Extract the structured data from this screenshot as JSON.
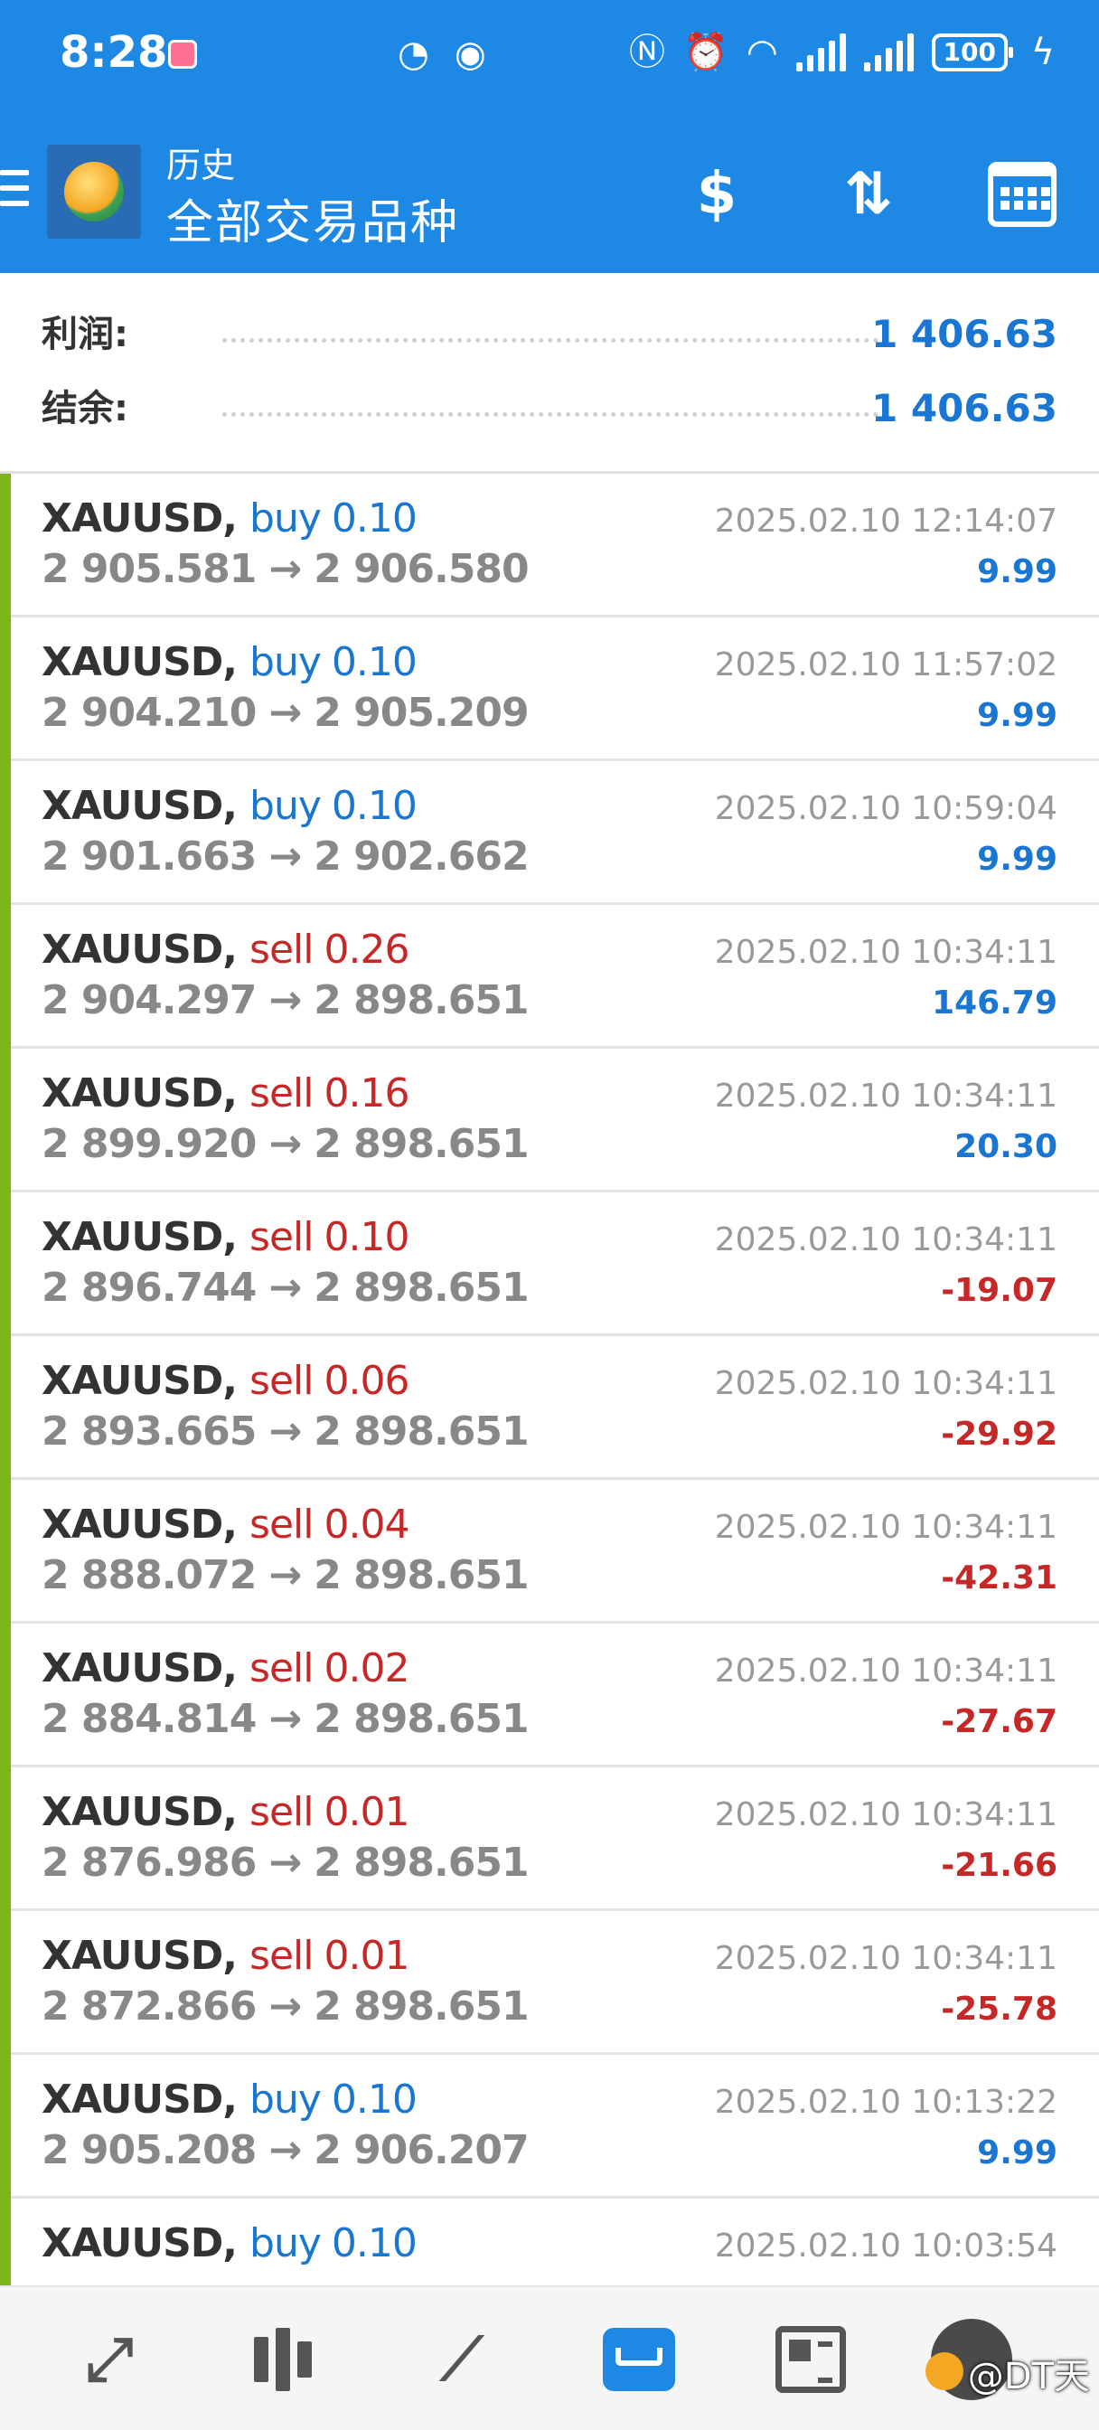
{
  "status_bar": {
    "time": "8:28",
    "battery": "100"
  },
  "app_bar": {
    "subtitle": "历史",
    "title": "全部交易品种"
  },
  "summary": {
    "profit_label": "利润:",
    "profit_value": "1 406.63",
    "balance_label": "结余:",
    "balance_value": "1 406.63"
  },
  "trades": [
    {
      "symbol": "XAUUSD,",
      "side": "buy",
      "volume": "0.10",
      "open": "2 905.581",
      "close": "2 906.580",
      "time": "2025.02.10 12:14:07",
      "profit": "9.99"
    },
    {
      "symbol": "XAUUSD,",
      "side": "buy",
      "volume": "0.10",
      "open": "2 904.210",
      "close": "2 905.209",
      "time": "2025.02.10 11:57:02",
      "profit": "9.99"
    },
    {
      "symbol": "XAUUSD,",
      "side": "buy",
      "volume": "0.10",
      "open": "2 901.663",
      "close": "2 902.662",
      "time": "2025.02.10 10:59:04",
      "profit": "9.99"
    },
    {
      "symbol": "XAUUSD,",
      "side": "sell",
      "volume": "0.26",
      "open": "2 904.297",
      "close": "2 898.651",
      "time": "2025.02.10 10:34:11",
      "profit": "146.79"
    },
    {
      "symbol": "XAUUSD,",
      "side": "sell",
      "volume": "0.16",
      "open": "2 899.920",
      "close": "2 898.651",
      "time": "2025.02.10 10:34:11",
      "profit": "20.30"
    },
    {
      "symbol": "XAUUSD,",
      "side": "sell",
      "volume": "0.10",
      "open": "2 896.744",
      "close": "2 898.651",
      "time": "2025.02.10 10:34:11",
      "profit": "-19.07"
    },
    {
      "symbol": "XAUUSD,",
      "side": "sell",
      "volume": "0.06",
      "open": "2 893.665",
      "close": "2 898.651",
      "time": "2025.02.10 10:34:11",
      "profit": "-29.92"
    },
    {
      "symbol": "XAUUSD,",
      "side": "sell",
      "volume": "0.04",
      "open": "2 888.072",
      "close": "2 898.651",
      "time": "2025.02.10 10:34:11",
      "profit": "-42.31"
    },
    {
      "symbol": "XAUUSD,",
      "side": "sell",
      "volume": "0.02",
      "open": "2 884.814",
      "close": "2 898.651",
      "time": "2025.02.10 10:34:11",
      "profit": "-27.67"
    },
    {
      "symbol": "XAUUSD,",
      "side": "sell",
      "volume": "0.01",
      "open": "2 876.986",
      "close": "2 898.651",
      "time": "2025.02.10 10:34:11",
      "profit": "-21.66"
    },
    {
      "symbol": "XAUUSD,",
      "side": "sell",
      "volume": "0.01",
      "open": "2 872.866",
      "close": "2 898.651",
      "time": "2025.02.10 10:34:11",
      "profit": "-25.78"
    },
    {
      "symbol": "XAUUSD,",
      "side": "buy",
      "volume": "0.10",
      "open": "2 905.208",
      "close": "2 906.207",
      "time": "2025.02.10 10:13:22",
      "profit": "9.99"
    },
    {
      "symbol": "XAUUSD,",
      "side": "buy",
      "volume": "0.10",
      "open": "",
      "close": "",
      "time": "2025.02.10 10:03:54",
      "profit": ""
    }
  ],
  "arrow": "→",
  "colors": {
    "header_blue": "#1e88e5",
    "buy_blue": "#1976d2",
    "sell_red": "#c62828",
    "row_accent_green": "#7cb518"
  },
  "bottom_nav": {
    "items": [
      "quotes-icon",
      "chart-icon",
      "trade-icon",
      "history-icon",
      "news-icon",
      "settings-icon"
    ],
    "active": "history-icon"
  },
  "watermark": "@DT天"
}
